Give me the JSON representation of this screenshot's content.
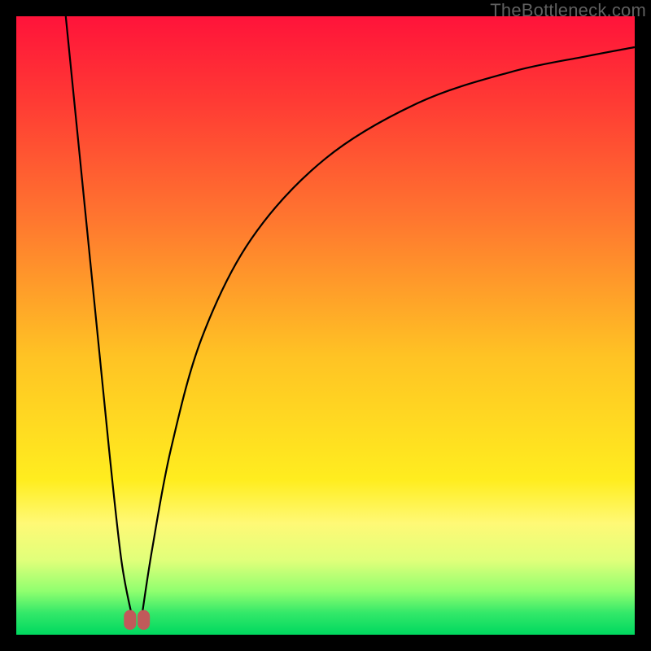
{
  "watermark": "TheBottleneck.com",
  "chart_data": {
    "type": "line",
    "title": "",
    "xlabel": "",
    "ylabel": "",
    "xlim": [
      0,
      100
    ],
    "ylim": [
      0,
      100
    ],
    "background_gradient_stops": [
      {
        "offset": 0,
        "color": "#ff133a"
      },
      {
        "offset": 0.14,
        "color": "#ff3b34"
      },
      {
        "offset": 0.33,
        "color": "#ff772f"
      },
      {
        "offset": 0.55,
        "color": "#ffc324"
      },
      {
        "offset": 0.75,
        "color": "#ffed1f"
      },
      {
        "offset": 0.82,
        "color": "#fff976"
      },
      {
        "offset": 0.88,
        "color": "#e0ff7a"
      },
      {
        "offset": 0.93,
        "color": "#8fff6f"
      },
      {
        "offset": 0.965,
        "color": "#33e869"
      },
      {
        "offset": 1.0,
        "color": "#00d85f"
      }
    ],
    "series": [
      {
        "name": "left-branch",
        "x": [
          8.0,
          12.0,
          15.0,
          17.0,
          18.7
        ],
        "y": [
          100.0,
          60.0,
          30.0,
          12.0,
          3.0
        ]
      },
      {
        "name": "right-branch",
        "x": [
          20.3,
          22.0,
          25.0,
          30.0,
          38.0,
          50.0,
          65.0,
          80.0,
          92.0,
          100.0
        ],
        "y": [
          3.0,
          14.0,
          30.0,
          48.0,
          64.0,
          77.0,
          86.0,
          91.0,
          93.5,
          95.0
        ]
      }
    ],
    "markers": [
      {
        "name": "left-min-marker",
        "x": 18.4,
        "y": 2.4,
        "w": 2.0,
        "h": 3.2,
        "color": "#c15a5a"
      },
      {
        "name": "right-min-marker",
        "x": 20.6,
        "y": 2.4,
        "w": 2.0,
        "h": 3.2,
        "color": "#c15a5a"
      }
    ]
  }
}
